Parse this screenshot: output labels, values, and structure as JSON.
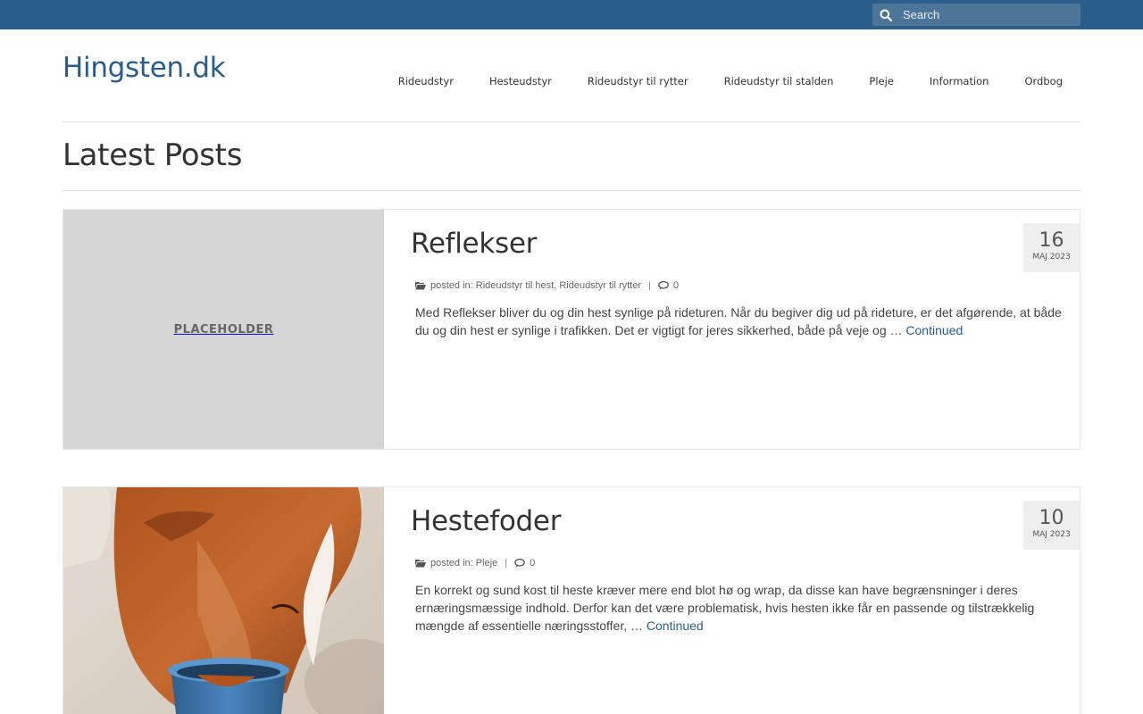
{
  "topbar": {
    "search_placeholder": "Search"
  },
  "header": {
    "site_title": "Hingsten.dk",
    "nav": [
      {
        "label": "Rideudstyr"
      },
      {
        "label": "Hesteudstyr"
      },
      {
        "label": "Rideudstyr til rytter"
      },
      {
        "label": "Rideudstyr til stalden"
      },
      {
        "label": "Pleje"
      },
      {
        "label": "Information"
      },
      {
        "label": "Ordbog"
      }
    ]
  },
  "page": {
    "title": "Latest Posts"
  },
  "posts": [
    {
      "title": "Reflekser",
      "day": "16",
      "month": "MAJ 2023",
      "meta_prefix": "posted in:",
      "categories": [
        "Rideudstyr til hest",
        "Rideudstyr til rytter"
      ],
      "comment_count": "0",
      "thumbnail_text": "PLACEHOLDER",
      "excerpt": "Med Reflekser bliver du og din hest synlige på rideturen. Når du begiver dig ud på rideture, er det afgørende, at både du og din hest er synlige i trafikken. Det er vigtigt for jeres sikkerhed, både på veje og …",
      "continue_label": "Continued"
    },
    {
      "title": "Hestefoder",
      "day": "10",
      "month": "MAJ 2023",
      "meta_prefix": "posted in:",
      "categories": [
        "Pleje"
      ],
      "comment_count": "0",
      "excerpt": "En korrekt og sund kost til heste kræver mere end blot hø og wrap, da disse kan have begrænsninger i deres ernæringsmæssige indhold. Derfor kan det være problematisk, hvis hesten ikke får en passende og tilstrækkelig mængde af essentielle næringsstoffer, …",
      "continue_label": "Continued"
    }
  ],
  "colors": {
    "topbar": "#2b5d8a",
    "link": "#2b5d8a",
    "date_box": "#eeeeee"
  }
}
